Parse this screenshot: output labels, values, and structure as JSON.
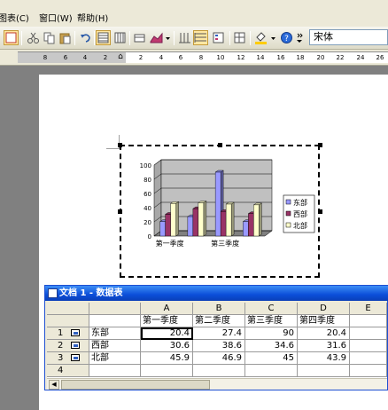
{
  "menu": {
    "items": [
      "图表(C)",
      "窗口(W)",
      "帮助(H)"
    ]
  },
  "toolbar": {
    "font_name": "宋体"
  },
  "ruler": {
    "labels": [
      "8",
      "6",
      "4",
      "2",
      "2",
      "2",
      "4",
      "6",
      "8",
      "10",
      "12",
      "14",
      "16",
      "18",
      "20",
      "22",
      "24",
      "26"
    ]
  },
  "datasheet": {
    "title": "文档 1 - 数据表",
    "columns": [
      "A",
      "B",
      "C",
      "D",
      "E"
    ],
    "headers": [
      "第一季度",
      "第二季度",
      "第三季度",
      "第四季度"
    ],
    "rows": [
      {
        "num": "1",
        "label": "东部",
        "values": [
          "20.4",
          "27.4",
          "90",
          "20.4"
        ]
      },
      {
        "num": "2",
        "label": "西部",
        "values": [
          "30.6",
          "38.6",
          "34.6",
          "31.6"
        ]
      },
      {
        "num": "3",
        "label": "北部",
        "values": [
          "45.9",
          "46.9",
          "45",
          "43.9"
        ]
      },
      {
        "num": "4"
      }
    ]
  },
  "chart_data": {
    "type": "bar",
    "categories": [
      "第一季度",
      "第二季度",
      "第三季度",
      "第四季度"
    ],
    "tick_labels": [
      "第一季度",
      "第三季度"
    ],
    "series": [
      {
        "name": "东部",
        "values": [
          20.4,
          27.4,
          90,
          20.4
        ],
        "color": "#9999ff"
      },
      {
        "name": "西部",
        "values": [
          30.6,
          38.6,
          34.6,
          31.6
        ],
        "color": "#993366"
      },
      {
        "name": "北部",
        "values": [
          45.9,
          46.9,
          45,
          43.9
        ],
        "color": "#ffffcc"
      }
    ],
    "ylim": [
      0,
      100
    ],
    "yticks": [
      "0",
      "20",
      "40",
      "60",
      "80",
      "100"
    ],
    "grid": true,
    "legend": "right"
  },
  "colors": {
    "title_bar": "#0b4ed9",
    "wall": "#c0c0c0"
  }
}
